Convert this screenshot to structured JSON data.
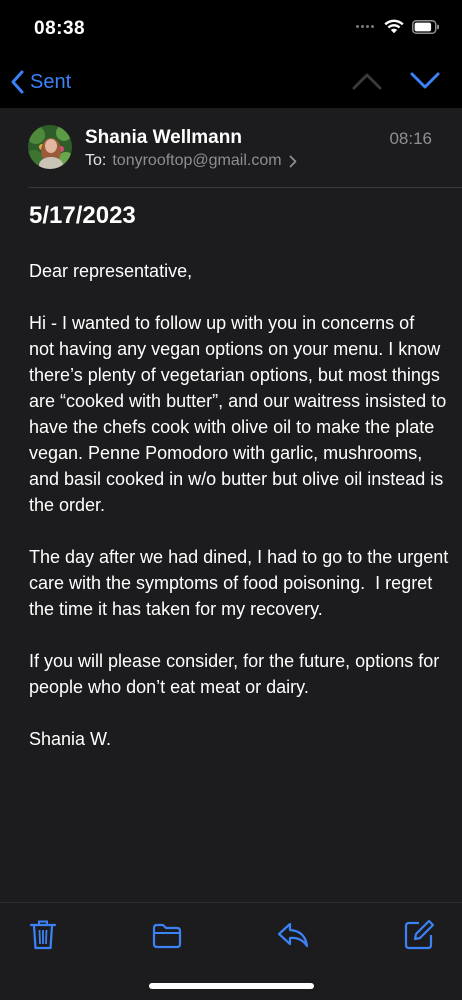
{
  "status_bar": {
    "time": "08:38",
    "icons": [
      "signal-dots-icon",
      "wifi-icon",
      "battery-icon"
    ]
  },
  "nav": {
    "back_label": "Sent",
    "accent_color": "#3b82f6",
    "up_icon": "chevron-up-icon",
    "down_icon": "chevron-down-icon"
  },
  "message": {
    "sender": "Shania Wellmann",
    "time": "08:16",
    "to_label": "To:",
    "to_address": "tonyrooftop@gmail.com",
    "subject": "5/17/2023",
    "paragraphs": [
      "Dear representative,",
      "Hi - I wanted to follow up with you in concerns of  not having any vegan options on your menu. I know there’s plenty of vegetarian options, but most things are “cooked with butter”, and our waitress insisted to have the chefs cook with olive oil to make the plate vegan. Penne Pomodoro with garlic, mushrooms, and basil cooked in w/o butter but olive oil instead is the order.",
      "The day after we had dined, I had to go to the urgent care with the symptoms of food poisoning.  I regret the time it has taken for my recovery.",
      "If you will please consider, for the future, options for people who don’t eat meat or dairy.",
      "Shania W."
    ]
  },
  "toolbar": {
    "icons": [
      "trash-icon",
      "folder-icon",
      "reply-icon",
      "compose-icon"
    ]
  }
}
